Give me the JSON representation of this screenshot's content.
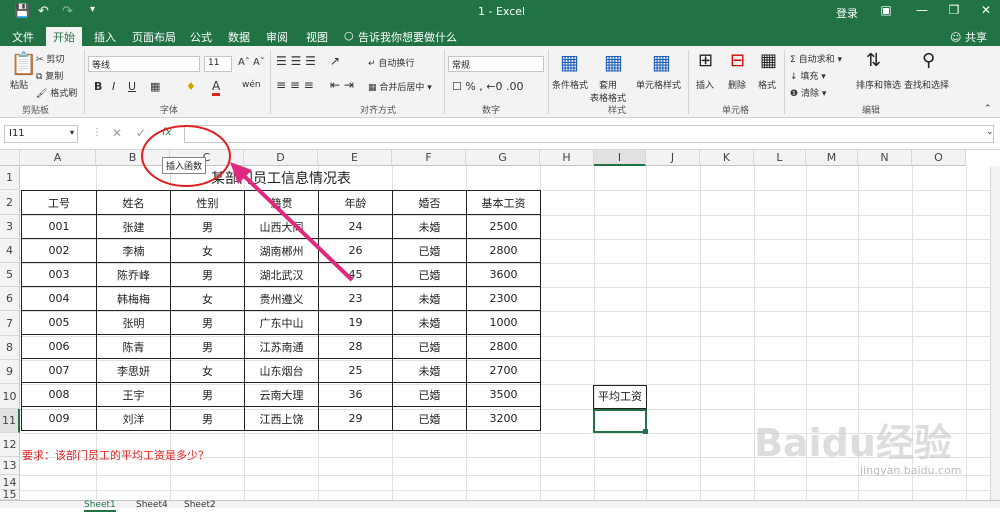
{
  "titlebar": {
    "title": "1  -  Excel",
    "login": "登录",
    "save_icon": "save-icon",
    "undo_icon": "undo-icon"
  },
  "tabs": [
    {
      "label": "文件"
    },
    {
      "label": "开始"
    },
    {
      "label": "插入"
    },
    {
      "label": "页面布局"
    },
    {
      "label": "公式"
    },
    {
      "label": "数据"
    },
    {
      "label": "审阅"
    },
    {
      "label": "视图"
    },
    {
      "label": "告诉我你想要做什么"
    }
  ],
  "share_label": "共享",
  "ribbon": {
    "paste": "粘贴",
    "cut": "剪切",
    "copy": "复制",
    "format_painter": "格式刷",
    "clipboard_group": "剪贴板",
    "font_name": "等线",
    "font_size": "11",
    "font_group": "字体",
    "wrap_text": "自动换行",
    "merge_center": "合并后居中",
    "align_group": "对齐方式",
    "number_format": "常规",
    "number_group": "数字",
    "cond_format": "条件格式",
    "table_format": "套用\n表格格式",
    "cell_style": "单元格样式",
    "style_group": "样式",
    "insert": "插入",
    "delete": "删除",
    "format": "格式",
    "cells_group": "单元格",
    "autosum": "自动求和",
    "fill": "填充",
    "clear": "清除",
    "sort_filter": "排序和筛选",
    "find_select": "查找和选择",
    "edit_group": "编辑",
    "bold": "B",
    "italic": "I",
    "underline": "U"
  },
  "formula_bar": {
    "namebox": "I11",
    "fx_tooltip": "插入函数",
    "fx_label": "fx"
  },
  "columns": [
    "A",
    "B",
    "C",
    "D",
    "E",
    "F",
    "G",
    "H",
    "I",
    "J",
    "K",
    "L",
    "M",
    "N",
    "O"
  ],
  "rows": [
    "1",
    "2",
    "3",
    "4",
    "5",
    "6",
    "7",
    "8",
    "9",
    "10",
    "11",
    "12",
    "13",
    "14",
    "15"
  ],
  "sheet": {
    "title": "某部门员工信息情况表",
    "headers": [
      "工号",
      "姓名",
      "性别",
      "籍贯",
      "年龄",
      "婚否",
      "基本工资"
    ],
    "records": [
      [
        "001",
        "张建",
        "男",
        "山西大同",
        "24",
        "未婚",
        "2500"
      ],
      [
        "002",
        "李楠",
        "女",
        "湖南郴州",
        "26",
        "已婚",
        "2800"
      ],
      [
        "003",
        "陈乔峰",
        "男",
        "湖北武汉",
        "45",
        "已婚",
        "3600"
      ],
      [
        "004",
        "韩梅梅",
        "女",
        "贵州遵义",
        "23",
        "未婚",
        "2300"
      ],
      [
        "005",
        "张明",
        "男",
        "广东中山",
        "19",
        "未婚",
        "1000"
      ],
      [
        "006",
        "陈青",
        "男",
        "江苏南通",
        "28",
        "已婚",
        "2800"
      ],
      [
        "007",
        "李思妍",
        "女",
        "山东烟台",
        "25",
        "未婚",
        "2700"
      ],
      [
        "008",
        "王宇",
        "男",
        "云南大理",
        "36",
        "已婚",
        "3500"
      ],
      [
        "009",
        "刘洋",
        "男",
        "江西上饶",
        "29",
        "已婚",
        "3200"
      ]
    ],
    "avg_label": "平均工资",
    "requirement": "要求：该部门员工的平均工资是多少？"
  },
  "sheet_tabs": [
    "Sheet1",
    "Sheet4",
    "Sheet2"
  ],
  "watermark": "Baidu经验",
  "watermark_url": "jingyan.baidu.com",
  "colors": {
    "excel_green": "#217346",
    "annotation": "#e0287f",
    "requirement_text": "#e02020"
  }
}
